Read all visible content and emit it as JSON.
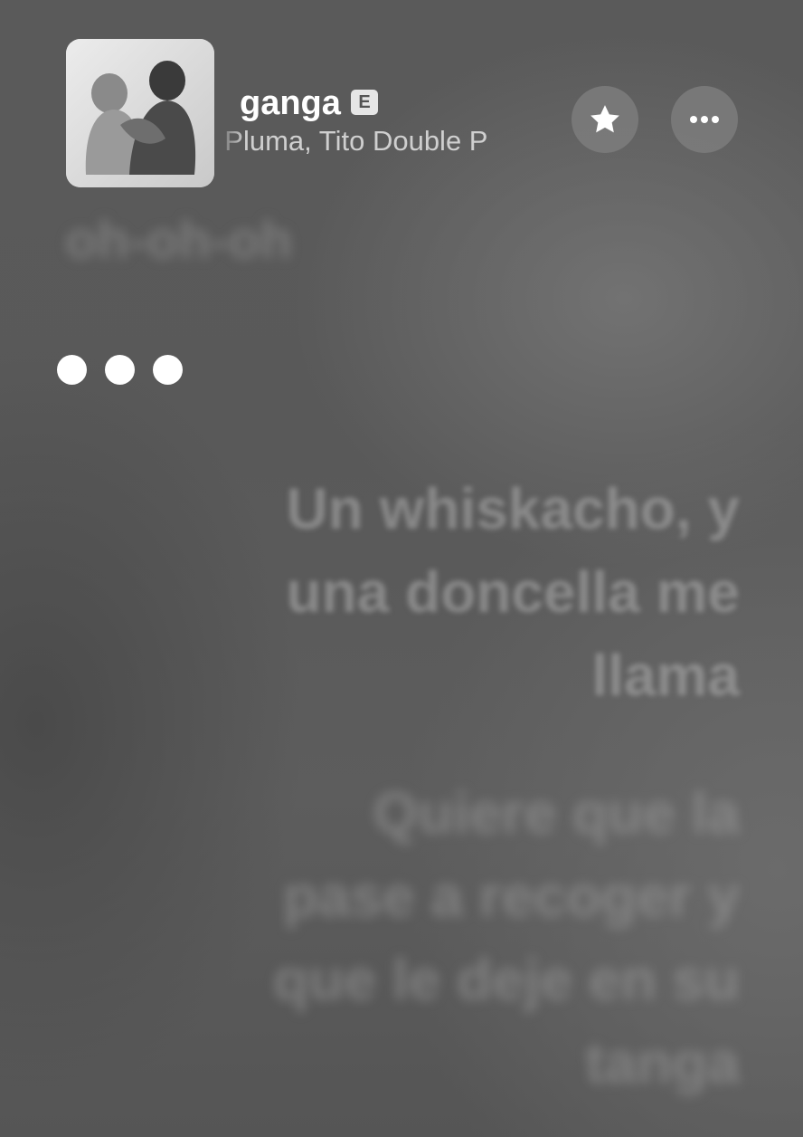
{
  "now_playing": {
    "title": "ganga",
    "explicit_badge": "E",
    "artist_visible": "Peso Pluma, Tito Double P"
  },
  "icons": {
    "favorite": "star-icon",
    "more": "ellipsis-icon",
    "waiting": "three-dots-indicator"
  },
  "lyrics": {
    "previous": "oh-oh-oh",
    "upcoming": [
      {
        "lines": [
          "Un whiskacho, y",
          "una doncella me",
          "llama"
        ]
      },
      {
        "lines": [
          "Quiere que la",
          "pase a recoger y",
          "que le deje en su",
          "tanga"
        ]
      }
    ]
  }
}
